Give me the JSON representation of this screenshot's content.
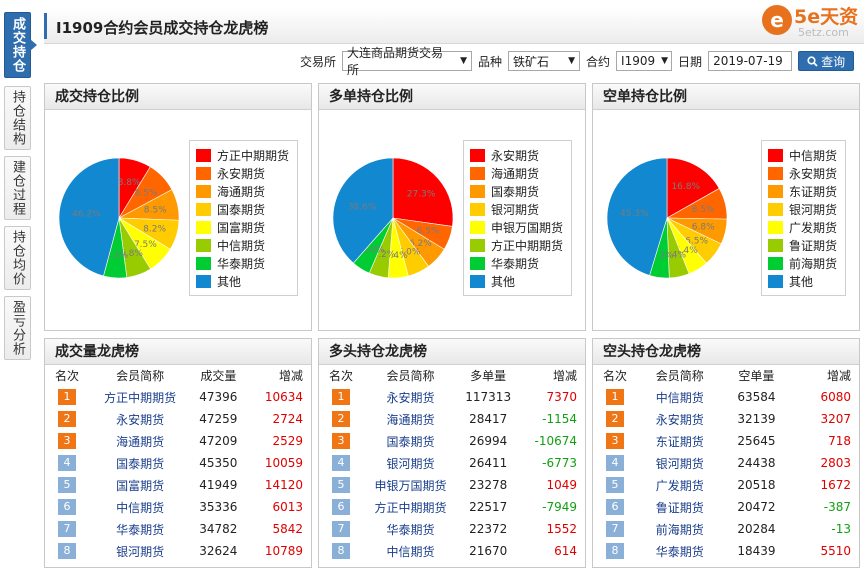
{
  "sidebar": {
    "tabs": [
      {
        "label": "成交持仓",
        "active": true
      },
      {
        "label": "持仓结构",
        "active": false
      },
      {
        "label": "建仓过程",
        "active": false
      },
      {
        "label": "持仓均价",
        "active": false
      },
      {
        "label": "盈亏分析",
        "active": false
      }
    ]
  },
  "header": {
    "title": "I1909合约会员成交持仓龙虎榜",
    "logo_mark": "e",
    "logo_text": "5e天资",
    "logo_url": "5etz.com"
  },
  "filters": {
    "exchange_label": "交易所",
    "exchange_value": "大连商品期货交易所",
    "product_label": "品种",
    "product_value": "铁矿石",
    "contract_label": "合约",
    "contract_value": "I1909",
    "date_label": "日期",
    "date_value": "2019-07-19",
    "query_label": "查询"
  },
  "colors": [
    "#ff0000",
    "#ff6600",
    "#ff9900",
    "#ffcc00",
    "#ffff00",
    "#99cc00",
    "#00cc33",
    "#1288d0"
  ],
  "chart_data": [
    {
      "type": "pie",
      "title": "成交持仓比例",
      "labels": [
        "方正中期期货",
        "永安期货",
        "海通期货",
        "国泰期货",
        "国富期货",
        "中信期货",
        "华泰期货",
        "其他"
      ],
      "values": [
        8.8,
        8.5,
        8.5,
        8.2,
        7.5,
        6.8,
        6.3,
        46.2
      ],
      "value_labels": [
        "8.8%",
        "8.5%",
        "8.5%",
        "8.2%",
        "7.5%",
        "6.8%",
        "6.3%",
        "46.2%"
      ],
      "legend": "right"
    },
    {
      "type": "pie",
      "title": "多单持仓比例",
      "labels": [
        "永安期货",
        "海通期货",
        "国泰期货",
        "银河期货",
        "申银万国期货",
        "方正中期期货",
        "华泰期货",
        "其他"
      ],
      "values": [
        27.3,
        6.5,
        6.2,
        6.0,
        5.4,
        5.2,
        5.0,
        38.6
      ],
      "value_labels": [
        "27.3%",
        "6.5%",
        "6.2%",
        "6.0%",
        "5.4%",
        "5.2%",
        "5.0%",
        "38.6%"
      ],
      "legend": "right"
    },
    {
      "type": "pie",
      "title": "空单持仓比例",
      "labels": [
        "中信期货",
        "永安期货",
        "东证期货",
        "银河期货",
        "广发期货",
        "鲁证期货",
        "前海期货",
        "其他"
      ],
      "values": [
        16.8,
        8.5,
        6.8,
        6.5,
        5.4,
        5.4,
        5.3,
        45.3
      ],
      "value_labels": [
        "16.8%",
        "8.5%",
        "6.8%",
        "6.5%",
        "5.4%",
        "5.4%",
        "5.3%",
        "45.3%"
      ],
      "legend": "right"
    }
  ],
  "tables": [
    {
      "title": "成交量龙虎榜",
      "headers": [
        "名次",
        "会员简称",
        "成交量",
        "增减"
      ],
      "rows": [
        {
          "rank": "1",
          "name": "方正中期期货",
          "value": "47396",
          "change": "10634",
          "dir": "pos"
        },
        {
          "rank": "2",
          "name": "永安期货",
          "value": "47259",
          "change": "2724",
          "dir": "pos"
        },
        {
          "rank": "3",
          "name": "海通期货",
          "value": "47209",
          "change": "2529",
          "dir": "pos"
        },
        {
          "rank": "4",
          "name": "国泰期货",
          "value": "45350",
          "change": "10059",
          "dir": "pos"
        },
        {
          "rank": "5",
          "name": "国富期货",
          "value": "41949",
          "change": "14120",
          "dir": "pos"
        },
        {
          "rank": "6",
          "name": "中信期货",
          "value": "35336",
          "change": "6013",
          "dir": "pos"
        },
        {
          "rank": "7",
          "name": "华泰期货",
          "value": "34782",
          "change": "5842",
          "dir": "pos"
        },
        {
          "rank": "8",
          "name": "银河期货",
          "value": "32624",
          "change": "10789",
          "dir": "pos"
        }
      ]
    },
    {
      "title": "多头持仓龙虎榜",
      "headers": [
        "名次",
        "会员简称",
        "多单量",
        "增减"
      ],
      "rows": [
        {
          "rank": "1",
          "name": "永安期货",
          "value": "117313",
          "change": "7370",
          "dir": "pos"
        },
        {
          "rank": "2",
          "name": "海通期货",
          "value": "28417",
          "change": "-1154",
          "dir": "neg"
        },
        {
          "rank": "3",
          "name": "国泰期货",
          "value": "26994",
          "change": "-10674",
          "dir": "neg"
        },
        {
          "rank": "4",
          "name": "银河期货",
          "value": "26411",
          "change": "-6773",
          "dir": "neg"
        },
        {
          "rank": "5",
          "name": "申银万国期货",
          "value": "23278",
          "change": "1049",
          "dir": "pos"
        },
        {
          "rank": "6",
          "name": "方正中期期货",
          "value": "22517",
          "change": "-7949",
          "dir": "neg"
        },
        {
          "rank": "7",
          "name": "华泰期货",
          "value": "22372",
          "change": "1552",
          "dir": "pos"
        },
        {
          "rank": "8",
          "name": "中信期货",
          "value": "21670",
          "change": "614",
          "dir": "pos"
        }
      ]
    },
    {
      "title": "空头持仓龙虎榜",
      "headers": [
        "名次",
        "会员简称",
        "空单量",
        "增减"
      ],
      "rows": [
        {
          "rank": "1",
          "name": "中信期货",
          "value": "63584",
          "change": "6080",
          "dir": "pos"
        },
        {
          "rank": "2",
          "name": "永安期货",
          "value": "32139",
          "change": "3207",
          "dir": "pos"
        },
        {
          "rank": "3",
          "name": "东证期货",
          "value": "25645",
          "change": "718",
          "dir": "pos"
        },
        {
          "rank": "4",
          "name": "银河期货",
          "value": "24438",
          "change": "2803",
          "dir": "pos"
        },
        {
          "rank": "5",
          "name": "广发期货",
          "value": "20518",
          "change": "1672",
          "dir": "pos"
        },
        {
          "rank": "6",
          "name": "鲁证期货",
          "value": "20472",
          "change": "-387",
          "dir": "neg"
        },
        {
          "rank": "7",
          "name": "前海期货",
          "value": "20284",
          "change": "-13",
          "dir": "neg"
        },
        {
          "rank": "8",
          "name": "华泰期货",
          "value": "18439",
          "change": "5510",
          "dir": "pos"
        }
      ]
    }
  ]
}
